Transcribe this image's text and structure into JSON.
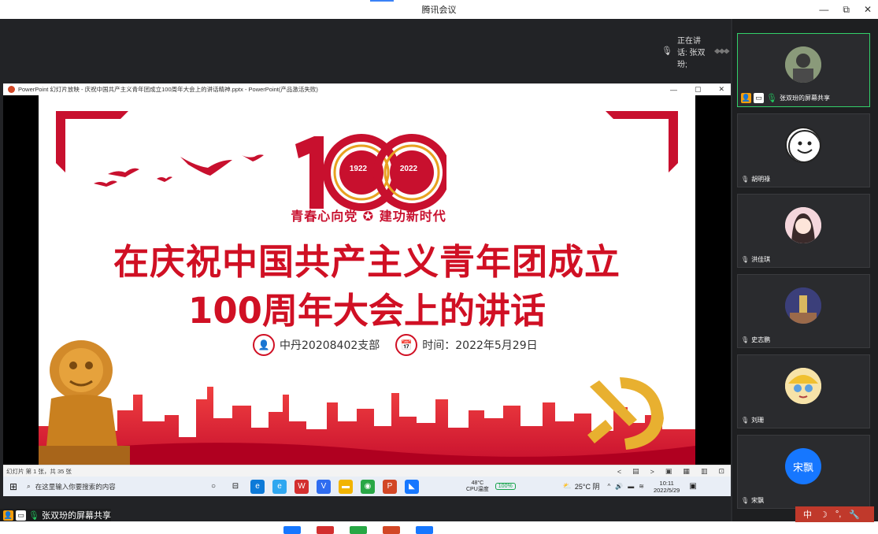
{
  "window": {
    "title": "腾讯会议",
    "controls": [
      "—",
      "⧉",
      "✕"
    ]
  },
  "meeting": {
    "speaking_label": "正在讲话: 张双玢;",
    "share_label": "张双玢的屏幕共享"
  },
  "ppt": {
    "title": "PowerPoint 幻灯片放映  -  庆祝中国共产主义青年团成立100周年大会上的讲话精神.pptx - PowerPoint(产品激活失败)",
    "controls": [
      "—",
      "▢",
      "✕"
    ],
    "status": "幻灯片 第 1 张，共 35 张",
    "nav": [
      "<",
      "▤",
      ">",
      "▣",
      "▦",
      "▥",
      "⊡"
    ]
  },
  "slide": {
    "year_left": "1922",
    "year_right": "2022",
    "slogan": "青春心向党 ✪ 建功新时代",
    "title_line1": "在庆祝中国共产主义青年团成立",
    "title_line2": "100周年大会上的讲话",
    "branch": "中丹20208402支部",
    "time": "时间：2022年5月29日"
  },
  "taskbar": {
    "search_placeholder": "在这里输入你要搜索的内容",
    "cpu_temp": "48°C",
    "cpu_label": "CPU温度",
    "cpu_badge": "100%",
    "weather": "25°C  阴",
    "time": "10:11",
    "date": "2022/5/29"
  },
  "participants": [
    {
      "name": "张双玢的屏幕共享",
      "active": true
    },
    {
      "name": "胡明祿"
    },
    {
      "name": "洪佳琪"
    },
    {
      "name": "史志鹏"
    },
    {
      "name": "刘珊"
    },
    {
      "name": "宋飘",
      "initials": "宋飘"
    }
  ],
  "ime": {
    "lang": "中",
    "icons": [
      "☽",
      "°,",
      "🔧"
    ]
  },
  "colors": {
    "accent_red": "#d01024",
    "active_green": "#33d06a",
    "avatar_blue": "#1677ff"
  }
}
